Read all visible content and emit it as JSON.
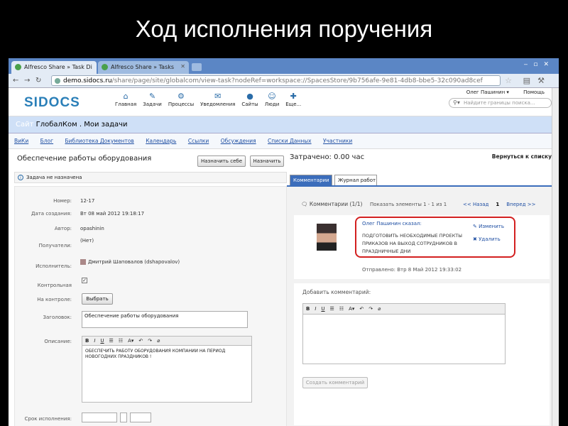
{
  "slide": {
    "title": "Ход исполнения поручения"
  },
  "browser": {
    "tabs": [
      {
        "label": "Alfresco Share » Task Di",
        "active": true
      },
      {
        "label": "Alfresco Share » Tasks",
        "active": false
      }
    ],
    "url_host": "demo.sidocs.ru",
    "url_path": "/share/page/site/globalcom/view-task?nodeRef=workspace://SpacesStore/9b756afe-9e81-4db8-bbe5-32c090ad8cef"
  },
  "app": {
    "logo": "SIDOCS",
    "nav": [
      {
        "icon": "home-icon",
        "glyph": "⌂",
        "label": "Главная"
      },
      {
        "icon": "tasks-icon",
        "glyph": "✎",
        "label": "Задачи"
      },
      {
        "icon": "processes-icon",
        "glyph": "⚙",
        "label": "Процессы"
      },
      {
        "icon": "notifications-icon",
        "glyph": "✉",
        "label": "Уведомления"
      },
      {
        "icon": "sites-icon",
        "glyph": "●",
        "label": "Сайты"
      },
      {
        "icon": "people-icon",
        "glyph": "☺",
        "label": "Люди"
      },
      {
        "icon": "more-icon",
        "glyph": "✚",
        "label": "Еще..."
      }
    ],
    "user": "Олег Пашинин ▾",
    "help": "Помощь",
    "search_placeholder": "Найдите границы поиска..."
  },
  "site": {
    "prefix": "Сайт",
    "name": "ГлобалКом . Мои задачи",
    "links": [
      "ВиКи",
      "Блог",
      "Библиотека Документов",
      "Календарь",
      "Ссылки",
      "Обсуждения",
      "Списки Данных",
      "Участники"
    ]
  },
  "task": {
    "title": "Обеспечение работы оборудования",
    "assign_self": "Назначить себе",
    "assign": "Назначить",
    "notice": "Задача не назначена",
    "fields": {
      "number_label": "Номер:",
      "number": "12-17",
      "created_label": "Дата создания:",
      "created": "Вт 08 май 2012 19:18:17",
      "author_label": "Автор:",
      "author": "opashinin",
      "recipients_label": "Получатели:",
      "recipients": "(Нет)",
      "executor_label": "Исполнитель:",
      "executor": "Дмитрий Шаповалов (dshapovalov)",
      "control_label": "Контрольная",
      "control_checked": true,
      "controller_label": "На контроле:",
      "controller_button": "Выбрать",
      "subject_label": "Заголовок:",
      "subject": "Обеспечение работы оборудования",
      "description_label": "Описание:",
      "description": "ОБЕСПЕЧИТЬ РАБОТУ ОБОРУДОВАНИЯ КОМПАНИИ НА ПЕРИОД НОВОГОДНИХ ПРАЗДНИКОВ !",
      "due_label": "Срок исполнения:"
    }
  },
  "right": {
    "spent": "Затрачено: 0.00 час",
    "back": "Вернуться к списку",
    "tabs": [
      "Комментарии",
      "Журнал работ"
    ],
    "comments_header": "Комментарии (1/1)",
    "show_items": "Показать элементы 1 - 1 из 1",
    "prev": "<< Назад",
    "page": "1",
    "next": "Вперед >>",
    "comment": {
      "author": "Олег Пашинин сказал:",
      "text": "ПОДГОТОВИТЬ НЕОБХОДИМЫЕ ПРОЕКТЫ ПРИКАЗОВ НА ВЫХОД СОТРУДНИКОВ В ПРАЗДНИЧНЫЕ ДНИ",
      "edit": "Изменить",
      "delete": "Удалить",
      "sent": "Отправлено: Втр 8 Май 2012 19:33:02"
    },
    "add_label": "Добавить комментарий:",
    "add_button": "Создать комментарий"
  },
  "colors": {
    "accent": "#3b6dbb",
    "highlight": "#d32020",
    "logo": "#2a7fb8"
  }
}
